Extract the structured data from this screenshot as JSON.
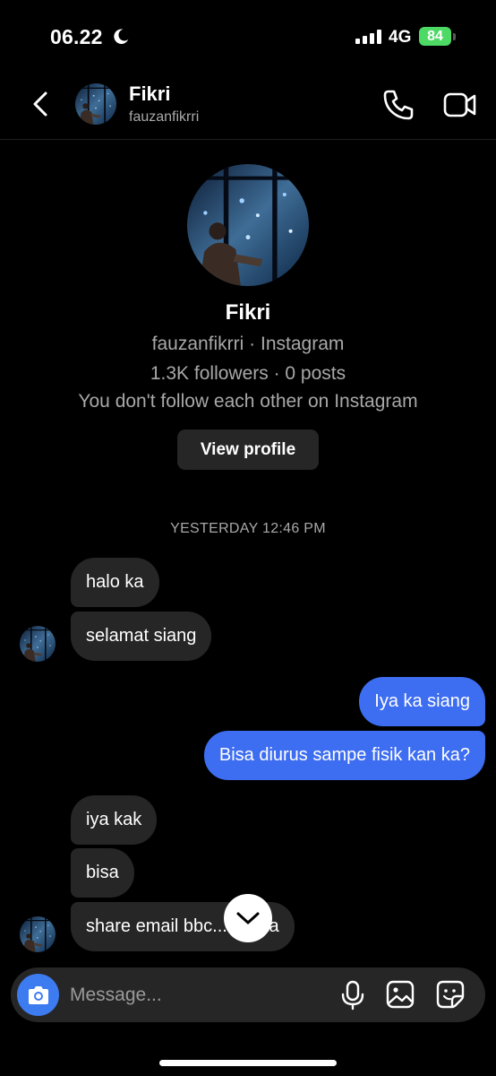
{
  "status_bar": {
    "time": "06.22",
    "network": "4G",
    "battery": "84"
  },
  "header": {
    "name": "Fikri",
    "username": "fauzanfikrri"
  },
  "profile": {
    "name": "Fikri",
    "username_line": "fauzanfikrri · Instagram",
    "stats_line": "1.3K followers · 0 posts",
    "follow_line": "You don't follow each other on Instagram",
    "view_profile_label": "View profile"
  },
  "chat": {
    "timestamp": "YESTERDAY 12:46 PM",
    "messages": [
      {
        "from": "them",
        "text": "halo ka"
      },
      {
        "from": "them",
        "text": "selamat siang"
      },
      {
        "from": "me",
        "text": "Iya ka siang"
      },
      {
        "from": "me",
        "text": "Bisa diurus sampe fisik kan ka?"
      },
      {
        "from": "them",
        "text": "iya kak"
      },
      {
        "from": "them",
        "text": "bisa"
      },
      {
        "from": "them",
        "text": "share email bbc... iya ka"
      }
    ]
  },
  "composer": {
    "placeholder": "Message..."
  },
  "colors": {
    "outgoing_bubble": "#3d6df1",
    "incoming_bubble": "#262626",
    "camera_button": "#3d7bf0",
    "battery": "#4cd964"
  },
  "icons": [
    "moon-icon",
    "back-icon",
    "phone-icon",
    "video-icon",
    "camera-icon",
    "mic-icon",
    "gallery-icon",
    "sticker-icon",
    "chevron-down-icon"
  ]
}
